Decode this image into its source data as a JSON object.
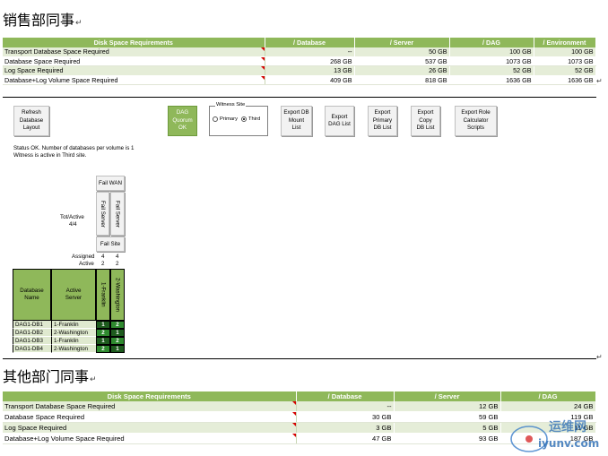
{
  "sections": [
    {
      "heading": "销售部同事",
      "table": {
        "headers": [
          "Disk Space Requirements",
          "/ Database",
          "/ Server",
          "/ DAG",
          "/ Environment"
        ],
        "rows": [
          {
            "label": "Transport Database Space Required",
            "values": [
              "--",
              "50 GB",
              "100 GB",
              "100 GB"
            ]
          },
          {
            "label": "Database Space Required",
            "values": [
              "268 GB",
              "537 GB",
              "1073 GB",
              "1073 GB"
            ]
          },
          {
            "label": "Log Space Required",
            "values": [
              "13 GB",
              "26 GB",
              "52 GB",
              "52 GB"
            ]
          },
          {
            "label": "Database+Log Volume Space Required",
            "values": [
              "409 GB",
              "818 GB",
              "1636 GB",
              "1636 GB"
            ]
          }
        ]
      }
    },
    {
      "heading": "其他部门同事",
      "table": {
        "headers": [
          "Disk Space Requirements",
          "/ Database",
          "/ Server",
          "/ DAG"
        ],
        "rows": [
          {
            "label": "Transport Database Space Required",
            "values": [
              "--",
              "12 GB",
              "24 GB"
            ]
          },
          {
            "label": "Database Space Required",
            "values": [
              "30 GB",
              "59 GB",
              "119 GB"
            ]
          },
          {
            "label": "Log Space Required",
            "values": [
              "3 GB",
              "5 GB",
              "11 GB"
            ]
          },
          {
            "label": "Database+Log Volume Space Required",
            "values": [
              "47 GB",
              "93 GB",
              "187 GB"
            ]
          }
        ]
      }
    }
  ],
  "buttons": {
    "refresh": "Refresh\nDatabase\nLayout",
    "dag_quorum": "DAG\nQuorum\nOK",
    "export_db_mount": "Export DB\nMount\nList",
    "export_dag": "Export\nDAG List",
    "export_primary": "Export\nPrimary\nDB List",
    "export_copy": "Export\nCopy\nDB List",
    "export_role": "Export Role\nCalculator\nScripts"
  },
  "witness": {
    "title": "Witness Site",
    "options": [
      "Primary",
      "Third"
    ],
    "selected": "Third"
  },
  "status": {
    "line1": "Status OK.  Number of databases per volume is 1",
    "line2": "Witness is active in Third site."
  },
  "failover": {
    "fail_wan": "Fail WAN",
    "fail_server_1": "Fail Server",
    "fail_server_2": "Fail Server",
    "fail_site": "Fail Site",
    "tot_active_label": "Tot/Active",
    "tot_active_value": "4/4"
  },
  "counts": {
    "assigned_label": "Assigned",
    "active_label": "Active",
    "assigned": [
      "4",
      "4"
    ],
    "active": [
      "2",
      "2"
    ]
  },
  "db_grid": {
    "col_name": "Database\nName",
    "col_active": "Active\nServer",
    "servers": [
      "1-Franklin",
      "2-Washington"
    ],
    "rows": [
      {
        "name": "DAG1-DB1",
        "active": "1-Franklin",
        "values": [
          "1",
          "2"
        ]
      },
      {
        "name": "DAG1-DB2",
        "active": "2-Washington",
        "values": [
          "2",
          "1"
        ]
      },
      {
        "name": "DAG1-DB3",
        "active": "1-Franklin",
        "values": [
          "1",
          "2"
        ]
      },
      {
        "name": "DAG1-DB4",
        "active": "2-Washington",
        "values": [
          "2",
          "1"
        ]
      }
    ]
  },
  "watermark": {
    "brand": "运维网",
    "site": "iyunv.com"
  }
}
